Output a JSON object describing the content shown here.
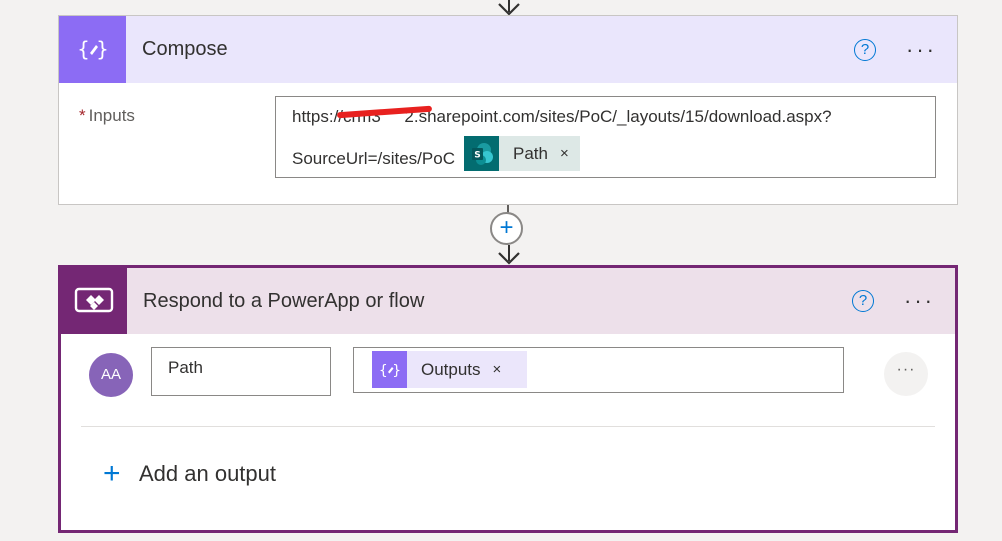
{
  "compose": {
    "title": "Compose",
    "icon": "braces-icon",
    "inputs_label": "Inputs",
    "required_marker": "*",
    "url_line1": "https://crm3     2.sharepoint.com/sites/PoC/_layouts/15/download.aspx?",
    "url_line2": "SourceUrl=/sites/PoC",
    "token": {
      "label": "Path",
      "icon": "sharepoint-icon",
      "remove": "×"
    }
  },
  "connector": {
    "add_step_label": "+"
  },
  "respond": {
    "title": "Respond to a PowerApp or flow",
    "icon": "powerapps-icon",
    "avatar_text": "AA",
    "output_name": "Path",
    "output_token": {
      "label": "Outputs",
      "icon": "braces-icon",
      "remove": "×"
    },
    "row_more": "···",
    "add_output_label": "Add an output"
  },
  "header_actions": {
    "help": "?",
    "more": "···"
  },
  "colors": {
    "compose_accent": "#8c6cf4",
    "compose_header_bg": "#eae6fc",
    "powerapps_accent": "#742774",
    "sharepoint_accent": "#036c70",
    "link_blue": "#0078d4"
  }
}
